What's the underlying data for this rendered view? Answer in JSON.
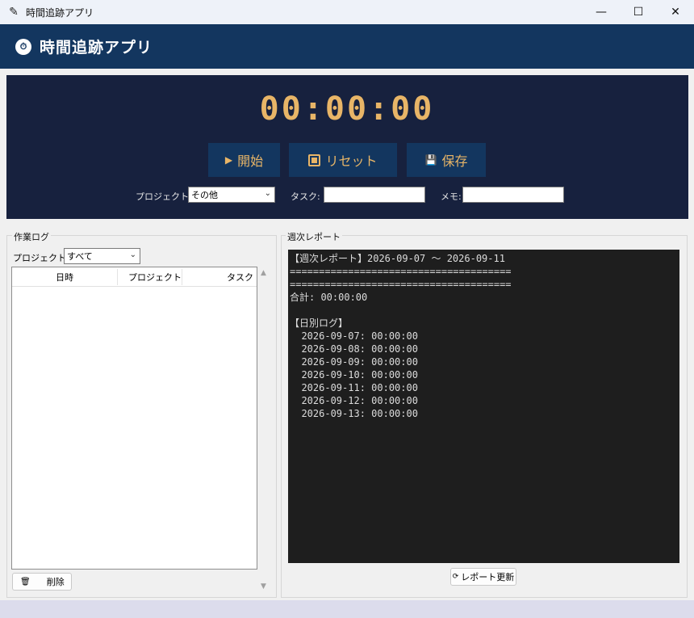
{
  "window": {
    "title": "時間追跡アプリ",
    "controls": [
      "—",
      "☐",
      "✕"
    ]
  },
  "header": {
    "title": "時間追跡アプリ",
    "icon": "stopwatch-icon"
  },
  "timer": {
    "display": "00:00:00",
    "start_label": "開始",
    "reset_label": "リセット",
    "save_label": "保存",
    "project_label": "プロジェクト:",
    "project_value": "その他",
    "task_label": "タスク:",
    "task_value": "",
    "memo_label": "メモ:",
    "memo_value": ""
  },
  "work_log": {
    "title": "作業ログ",
    "filter_label": "プロジェクト:",
    "filter_value": "すべて",
    "columns": [
      "日時",
      "プロジェクト",
      "タスク"
    ],
    "rows": [],
    "delete_label": "削除"
  },
  "weekly_report": {
    "title": "週次レポート",
    "lines": [
      "【週次レポート】2026-09-07 ～ 2026-09-11",
      "======================================",
      "======================================",
      "合計: 00:00:00",
      "",
      "【日別ログ】",
      "  2026-09-07: 00:00:00",
      "  2026-09-08: 00:00:00",
      "  2026-09-09: 00:00:00",
      "  2026-09-10: 00:00:00",
      "  2026-09-11: 00:00:00",
      "  2026-09-12: 00:00:00",
      "  2026-09-13: 00:00:00"
    ],
    "refresh_label": "レポート更新"
  },
  "colors": {
    "header_bg": "#13365f",
    "panel_bg": "#17213e",
    "accent": "#e8b567",
    "report_bg": "#1e1e1e"
  }
}
